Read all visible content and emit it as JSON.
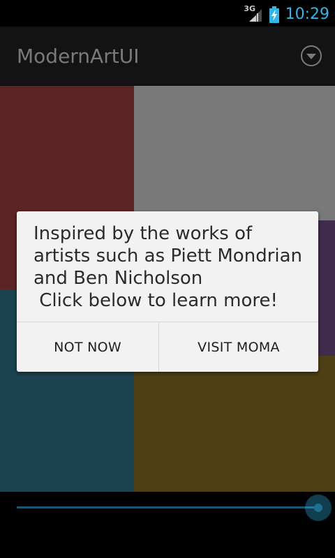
{
  "status_bar": {
    "network": "3G",
    "time": "10:29",
    "clock_color": "#33b5e5"
  },
  "action_bar": {
    "title": "ModernArtUI",
    "overflow_icon": "overflow-menu-icon"
  },
  "panels": [
    {
      "name": "red",
      "color": "#5c2523"
    },
    {
      "name": "gray",
      "color": "#797979"
    },
    {
      "name": "purple",
      "color": "#3e2b4d"
    },
    {
      "name": "teal",
      "color": "#1c4350"
    },
    {
      "name": "yellow",
      "color": "#4e3f14"
    }
  ],
  "dialog": {
    "message": "Inspired by the works of artists such as Piett Mondrian and Ben Nicholson\n Click below to learn more!",
    "negative_label": "NOT NOW",
    "positive_label": "VISIT MOMA"
  },
  "slider": {
    "value_fraction": 1.0,
    "accent_color": "#33b5e5"
  }
}
